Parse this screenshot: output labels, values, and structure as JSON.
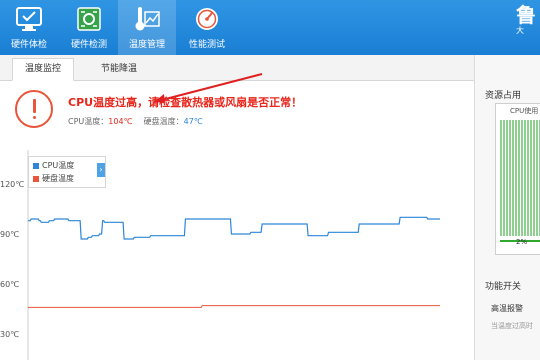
{
  "toolbar": {
    "items": [
      {
        "label": "硬件体检",
        "icon": "monitor-check-icon"
      },
      {
        "label": "硬件检测",
        "icon": "circuit-board-icon"
      },
      {
        "label": "温度管理",
        "icon": "thermometer-icon",
        "active": true
      },
      {
        "label": "性能测试",
        "icon": "speedometer-icon"
      }
    ],
    "brand": "鲁",
    "brand_sub": "大"
  },
  "tabs": [
    {
      "label": "温度监控",
      "active": true
    },
    {
      "label": "节能降温",
      "active": false
    }
  ],
  "alert": {
    "title": "CPU温度过高，请检查散热器或风扇是否正常！",
    "cpu_label": "CPU温度：",
    "cpu_value": "104℃",
    "disk_label": "硬盘温度：",
    "disk_value": "47℃"
  },
  "chart_data": {
    "type": "line",
    "ylim": [
      30,
      120
    ],
    "y_ticks": [
      "120℃",
      "90℃",
      "60℃",
      "30℃"
    ],
    "y_tick_values": [
      120,
      90,
      60,
      30
    ],
    "series": [
      {
        "name": "CPU温度",
        "color": "#2d86d8",
        "values": [
          98,
          98,
          98,
          99,
          99,
          99,
          99,
          99,
          99,
          99,
          99,
          98,
          98,
          97,
          97,
          97,
          97,
          97,
          97,
          97,
          97,
          98,
          98,
          98,
          98,
          98,
          99,
          99,
          99,
          99,
          99,
          99,
          99,
          99,
          99,
          99,
          99,
          99,
          99,
          99,
          98,
          98,
          98,
          98,
          98,
          98,
          98,
          98,
          98,
          98,
          98,
          98,
          87,
          87,
          87,
          87,
          87,
          87,
          87,
          88,
          88,
          88,
          88,
          89,
          89,
          89,
          89,
          89,
          89,
          89,
          90,
          90,
          90,
          98,
          98,
          97,
          97,
          97,
          97,
          97,
          97,
          97,
          97,
          97,
          97,
          97,
          97,
          97,
          97,
          97,
          97,
          97,
          97,
          97,
          87,
          87,
          87,
          87,
          87,
          87,
          87,
          87,
          87,
          87,
          88,
          88,
          88,
          88,
          88,
          88,
          88,
          88,
          88,
          88,
          88,
          88,
          88,
          88,
          88,
          88,
          89,
          89,
          89,
          89,
          89,
          89,
          89,
          89,
          89,
          89,
          89,
          89,
          89,
          89,
          89,
          89,
          89,
          89,
          89,
          89,
          89,
          89,
          89,
          89,
          89,
          89,
          89,
          89,
          89,
          89,
          89,
          89,
          89,
          89,
          99,
          99,
          99,
          99,
          99,
          99,
          99,
          99,
          99,
          99,
          99,
          99,
          99,
          99,
          99,
          99,
          99,
          99,
          99,
          99,
          99,
          99,
          99,
          99,
          99,
          99,
          99,
          99,
          99,
          99,
          99,
          99,
          99,
          99,
          99,
          99,
          99,
          99,
          99,
          99,
          99,
          99,
          99,
          99,
          99,
          90,
          90,
          90,
          90,
          90,
          90,
          90,
          90,
          90,
          90,
          90,
          90,
          90,
          90,
          90,
          90,
          90,
          90,
          90,
          91,
          91,
          91,
          91,
          91,
          91,
          91,
          91,
          91,
          91,
          91,
          96,
          96,
          96,
          96,
          96,
          96,
          96,
          96,
          96,
          96,
          96,
          96,
          96,
          96,
          96,
          96,
          96,
          96,
          96,
          96,
          96,
          96,
          96,
          96,
          96,
          96,
          96,
          96,
          96,
          96,
          96,
          96,
          96,
          96,
          96,
          96,
          96,
          96,
          96,
          96,
          96,
          96,
          96,
          96,
          96,
          89,
          89,
          89,
          89,
          89,
          89,
          89,
          89,
          89,
          89,
          89,
          89,
          89,
          89,
          89,
          89,
          89,
          89,
          89,
          89,
          91,
          91,
          91,
          91,
          91,
          91,
          91,
          91,
          91,
          91,
          91,
          91,
          91,
          91,
          91,
          91,
          91,
          91,
          91,
          91,
          91,
          91,
          91,
          91,
          91,
          91,
          91,
          91,
          91,
          91,
          96,
          96,
          96,
          96,
          96,
          96,
          96,
          96,
          96,
          96,
          96,
          96,
          96,
          96,
          96,
          96,
          96,
          96,
          96,
          96,
          96,
          96,
          96,
          96,
          96,
          96,
          96,
          96,
          96,
          96,
          96,
          96,
          96,
          96,
          96,
          96,
          96,
          96,
          96,
          96,
          100,
          100,
          100,
          100,
          100,
          100,
          100,
          100,
          100,
          100,
          100,
          100,
          100,
          100,
          100,
          100,
          100,
          100,
          100,
          100,
          100,
          100,
          100,
          100,
          100,
          100,
          100,
          99,
          99,
          99,
          99,
          99,
          99,
          99,
          99,
          99,
          99,
          99,
          99,
          99
        ]
      },
      {
        "name": "硬盘温度",
        "color": "#e8553b",
        "values": [
          46,
          46,
          46,
          46,
          46,
          46,
          46,
          46,
          46,
          46,
          46,
          46,
          46,
          46,
          46,
          46,
          46,
          46,
          46,
          46,
          46,
          46,
          46,
          46,
          46,
          46,
          46,
          46,
          46,
          46,
          46,
          46,
          46,
          46,
          46,
          46,
          46,
          46,
          46,
          46,
          46,
          46,
          46,
          46,
          46,
          46,
          46,
          46,
          46,
          46,
          46,
          46,
          46,
          46,
          46,
          46,
          46,
          46,
          46,
          46,
          46,
          46,
          46,
          46,
          46,
          46,
          46,
          46,
          46,
          46,
          46,
          46,
          46,
          46,
          46,
          46,
          46,
          46,
          46,
          46,
          46,
          46,
          46,
          46,
          46,
          46,
          46,
          46,
          46,
          46,
          46,
          46,
          46,
          46,
          46,
          46,
          46,
          46,
          46,
          46,
          46,
          46,
          46,
          46,
          46,
          46,
          46,
          46,
          46,
          46,
          46,
          46,
          46,
          46,
          46,
          46,
          46,
          46,
          46,
          46,
          46,
          46,
          46,
          46,
          46,
          46,
          46,
          46,
          46,
          46,
          46,
          46,
          46,
          46,
          46,
          46,
          46,
          46,
          46,
          46,
          46,
          46,
          46,
          46,
          46,
          46,
          46,
          46,
          46,
          46,
          46,
          46,
          46,
          46,
          46,
          46,
          46,
          46,
          46,
          46,
          46,
          46,
          46,
          46,
          46,
          46,
          46,
          46,
          46,
          46,
          46,
          46,
          46,
          46,
          46,
          46,
          46,
          46,
          47,
          47,
          47,
          47,
          47,
          47,
          47,
          47,
          47,
          47,
          47,
          47,
          47,
          47,
          47,
          47,
          47,
          47,
          47,
          47,
          47,
          47,
          47,
          47,
          47,
          47,
          47,
          47,
          47,
          47,
          47,
          47,
          47,
          47,
          47,
          47,
          47,
          47,
          47,
          47,
          47,
          47,
          47,
          47,
          47,
          47,
          47,
          47,
          47,
          47,
          47,
          47,
          47,
          47,
          47,
          47,
          47,
          47,
          47,
          47,
          47,
          47,
          47,
          47,
          47,
          47,
          47,
          47,
          47,
          47,
          47,
          47,
          47,
          47,
          47,
          47,
          47,
          47,
          47,
          47,
          47,
          47,
          47,
          47,
          47,
          47,
          47,
          47,
          47,
          47,
          47,
          47,
          47,
          47,
          47,
          47,
          47,
          47,
          47,
          47,
          47,
          47,
          47,
          47,
          47,
          47,
          47,
          47,
          47,
          47,
          47,
          47,
          47,
          47,
          47,
          47,
          47,
          47,
          47,
          47,
          47,
          47,
          47,
          47,
          47,
          47,
          47,
          47,
          47,
          47,
          47,
          47,
          47,
          47,
          47,
          47,
          47,
          47,
          47,
          47,
          47,
          47,
          47,
          47,
          47,
          47,
          47,
          47,
          47,
          47,
          47,
          47,
          47,
          47,
          47,
          47,
          47,
          47,
          47,
          47,
          47,
          47,
          47,
          47,
          47,
          47,
          47,
          47,
          47,
          47,
          47,
          47,
          47,
          47,
          47,
          47,
          47,
          47,
          47,
          47,
          47,
          47,
          47,
          47,
          47,
          47,
          47,
          47,
          47,
          47,
          47,
          47,
          47,
          47,
          47,
          47,
          47,
          47,
          47,
          47,
          47,
          47,
          47,
          47,
          47,
          47,
          47,
          47,
          47,
          47,
          47,
          47,
          47,
          47,
          47,
          47,
          47,
          47,
          47,
          47,
          47,
          47,
          47,
          47,
          47,
          47,
          47,
          47,
          47,
          47,
          47,
          47,
          47,
          47,
          47,
          47,
          47,
          47,
          47,
          47,
          47,
          47,
          47,
          47
        ]
      }
    ]
  },
  "resources": {
    "title": "资源占用",
    "meter_label": "CPU使用",
    "meter_value": "2%",
    "meter_fraction": 0.02
  },
  "features": {
    "title": "功能开关",
    "item": "高温报警",
    "sub": "当温度过高时"
  },
  "colors": {
    "header_blue": "#1a7fd4",
    "alert_red": "#e8261b",
    "cpu_line": "#2d86d8",
    "disk_line": "#e8553b"
  }
}
